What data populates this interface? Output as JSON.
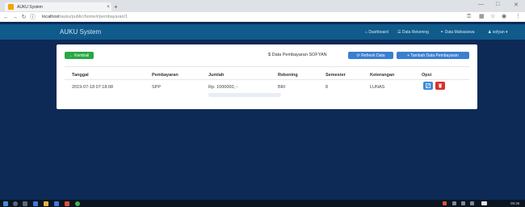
{
  "browser": {
    "tab_title": "AUKU System",
    "tab_close": "×",
    "new_tab": "+",
    "url_host": "localhost",
    "url_path": "/auku/public/home#/pembayaran/1",
    "icons": [
      "back-icon",
      "forward-icon",
      "reload-icon",
      "info-icon",
      "key-icon",
      "extension-icon",
      "star-icon",
      "profile-icon",
      "menu-icon"
    ]
  },
  "app": {
    "brand": "AUKU System",
    "menu": [
      "Dashboard",
      "Data Rekening",
      "Data Mahasiswa",
      "sofyan"
    ]
  },
  "toolbar": {
    "back_label": "← Kembali",
    "heading": "Data Pembayaran SOFYAN",
    "refresh_label": "Refresh Data",
    "add_label": "+ Tambah Data Pembayaran"
  },
  "table": {
    "headers": [
      "Tanggal",
      "Pembayaran",
      "Jumlah",
      "Rekening",
      "Semester",
      "Keterangan",
      "Opsi"
    ],
    "rows": [
      [
        "2019-07-18 07:18:08",
        "SPP",
        "Rp. 1000000, -",
        "BRI",
        "8",
        "LUNAS"
      ]
    ]
  },
  "colors": {
    "appbar": "#0f5b8c",
    "success": "#28a745",
    "primary": "#3a7fd0",
    "danger": "#d9302c",
    "desktop": "#0d2a57"
  },
  "taskbar": {
    "clock": "09:36"
  }
}
